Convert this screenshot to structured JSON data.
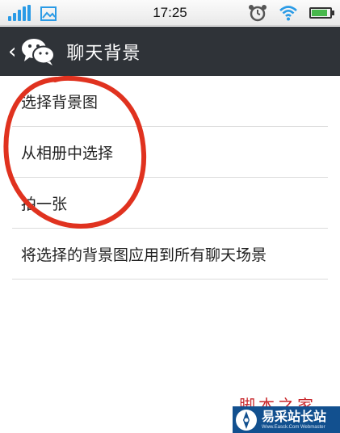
{
  "status_bar": {
    "time": "17:25",
    "icons": [
      "signal-icon",
      "gallery-icon",
      "alarm-icon",
      "wifi-icon",
      "battery-icon"
    ],
    "battery_level": 0.85,
    "signal_color": "#2b9be6"
  },
  "header": {
    "back_icon": "chevron-left-icon",
    "logo_icon": "wechat-logo-icon",
    "title": "聊天背景",
    "background_color": "#2f3338"
  },
  "menu": {
    "items": [
      {
        "label": "选择背景图"
      },
      {
        "label": "从相册中选择"
      },
      {
        "label": "拍一张"
      },
      {
        "label": "将选择的背景图应用到所有聊天场景"
      }
    ]
  },
  "annotation": {
    "color": "#e0321f",
    "shape": "ellipse"
  },
  "watermark": {
    "text": "脚本之家",
    "badge_title": "易采站长站",
    "badge_url": "Www.Easck.Com Webmaster",
    "badge_color": "#12508f"
  }
}
